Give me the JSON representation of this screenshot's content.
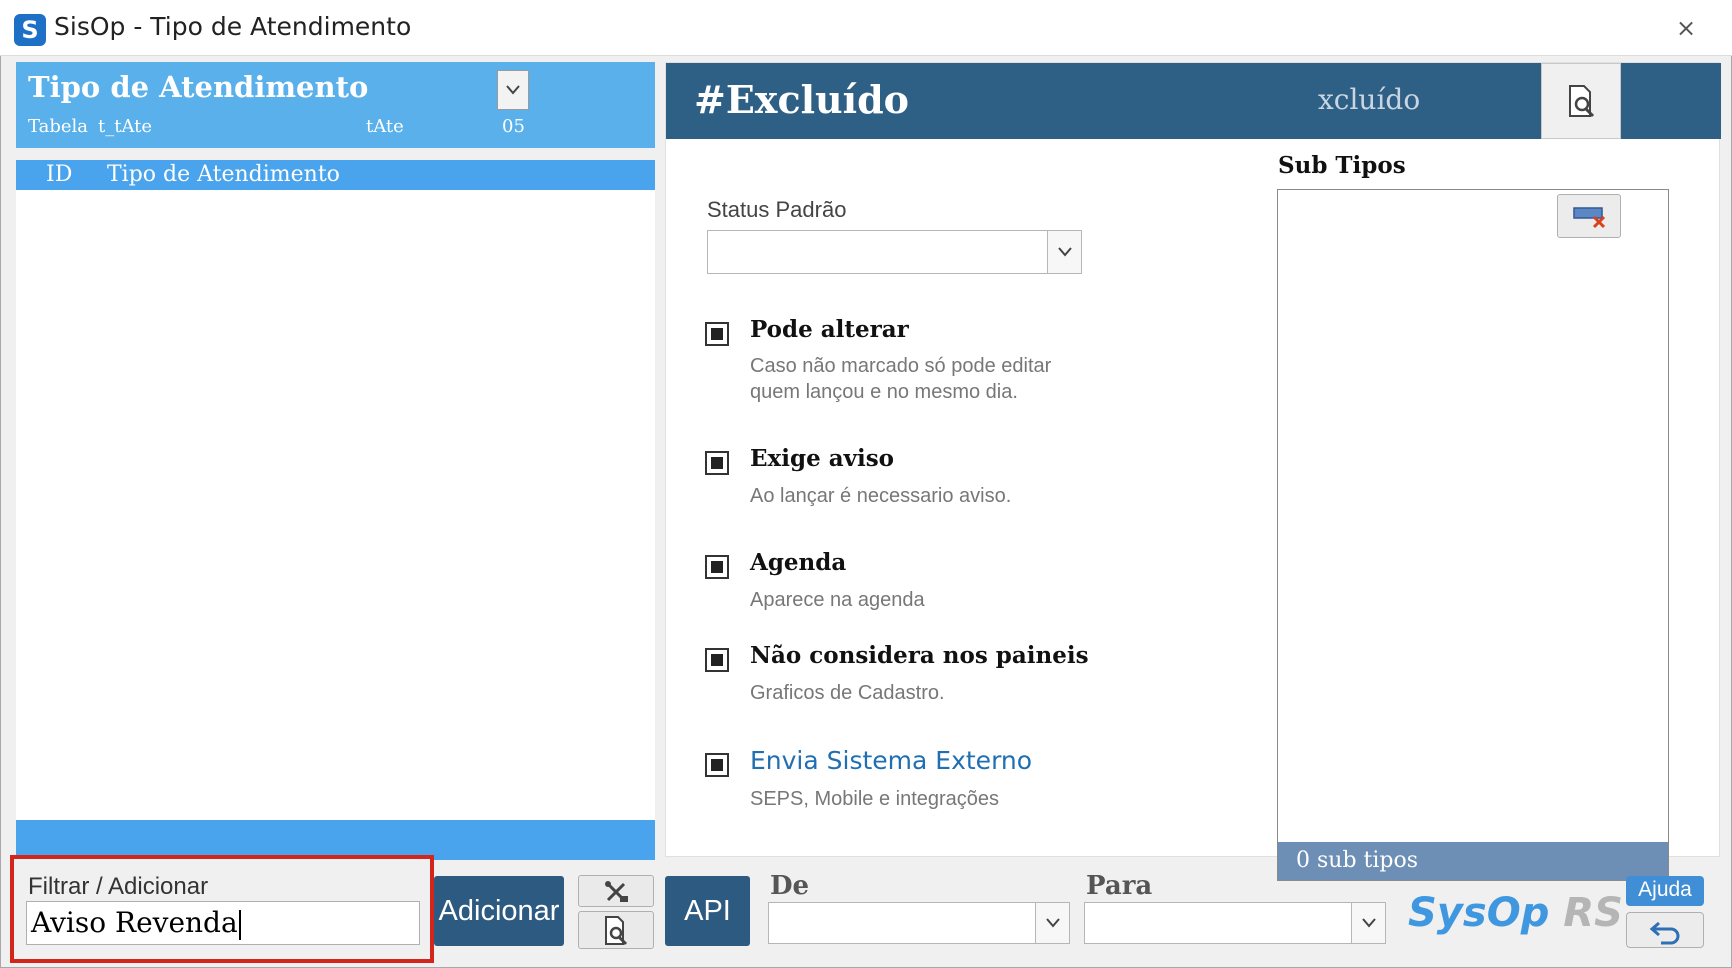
{
  "window": {
    "title": "SisOp - Tipo de Atendimento",
    "app_icon_glyph": "S",
    "close_glyph": "⨯"
  },
  "left_panel": {
    "title": "Tipo de Atendimento",
    "table_label": "Tabela",
    "table_name": "t_tAte",
    "table_code": "tAte",
    "table_number": "05",
    "columns": [
      "ID",
      "Tipo de Atendimento"
    ]
  },
  "detail": {
    "title": "#Excluído",
    "code": "xcluído",
    "status_label": "Status Padrão",
    "status_value": "",
    "options": [
      {
        "title": "Pode alterar",
        "desc_lines": [
          "Caso não marcado só pode editar",
          "quem lançou e no mesmo dia."
        ],
        "checked": true
      },
      {
        "title": "Exige aviso",
        "desc_lines": [
          "Ao lançar é necessario aviso."
        ],
        "checked": true
      },
      {
        "title": "Agenda",
        "desc_lines": [
          "Aparece na agenda"
        ],
        "checked": true
      },
      {
        "title": "Não considera nos paineis",
        "desc_lines": [
          "Graficos de Cadastro."
        ],
        "checked": true
      },
      {
        "title": "Envia Sistema Externo",
        "desc_lines": [
          "SEPS, Mobile e integrações"
        ],
        "checked": true
      }
    ],
    "subtypes": {
      "title": "Sub Tipos",
      "count_text": "0 sub tipos"
    }
  },
  "bottom": {
    "filter_label": "Filtrar / Adicionar",
    "filter_value": "Aviso Revenda",
    "add_button": "Adicionar",
    "api_button": "API",
    "from_label": "De",
    "to_label": "Para",
    "logo_part1": "SysOp",
    "logo_part2": "RS",
    "help_button": "Ajuda"
  },
  "colors": {
    "left_header": "#5ab0ea",
    "list_header": "#4aa4ed",
    "detail_header": "#2e5f85",
    "dark_button": "#2c5a80",
    "highlight_border": "#d3251c",
    "link": "#1f6fb2",
    "logo_blue": "#3f97e0",
    "logo_gray": "#b5b5b5"
  },
  "icons": {
    "dropdown": "chevron-down-icon",
    "search": "document-search-icon",
    "remove_subtype": "remove-list-icon",
    "tools": "tools-icon",
    "back": "undo-arrow-icon"
  }
}
